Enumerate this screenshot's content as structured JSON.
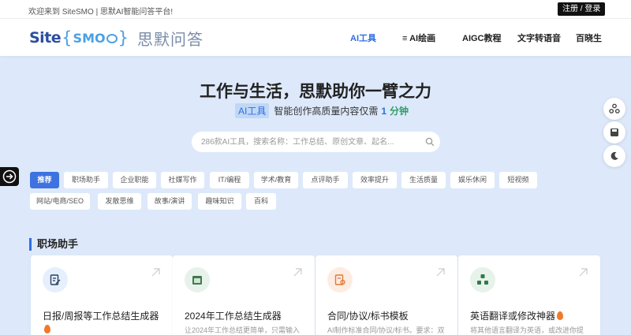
{
  "topbar": {
    "welcome": "欢迎来到 SiteSMO | 思默AI智能问答平台!",
    "login": "注册 / 登录"
  },
  "logo": {
    "site": "Site",
    "smo": "SMO",
    "cn": "思默问答"
  },
  "nav": {
    "ai_tools": "AI工具",
    "ai_paint": "≡ AI绘画",
    "aigc": "AIGC教程",
    "tts": "文字转语音",
    "baike": "百晓生"
  },
  "hero": {
    "title": "工作与生活，思默助你一臂之力",
    "tag": "AI工具",
    "sub_text": "智能创作高质量内容仅需",
    "num": "1",
    "unit": "分钟"
  },
  "search": {
    "placeholder": "286款AI工具，搜索名称：工作总结、原创文章、起名..."
  },
  "tags": [
    "推荐",
    "职场助手",
    "企业职能",
    "社媒写作",
    "IT/编程",
    "学术/教育",
    "点评助手",
    "效率提升",
    "生活质量",
    "娱乐休闲",
    "短视频",
    "网站/电商/SEO",
    "发散思维",
    "故事/演讲",
    "趣味知识",
    "百科"
  ],
  "section": {
    "title": "职场助手"
  },
  "cards": [
    {
      "title": "日报/周报等工作总结生成器",
      "desc": "",
      "hot": true
    },
    {
      "title": "2024年工作总结生成器",
      "desc": "让2024年工作总结更简单，只需输入",
      "hot": false
    },
    {
      "title": "合同/协议/标书模板",
      "desc": "AI制作标准合同/协议/标书。要求：双",
      "hot": false
    },
    {
      "title": "英语翻译或修改神器",
      "desc": "将其他语言翻译为英语，或改进你提",
      "hot": true
    }
  ],
  "colors": {
    "accent": "#2f6fe0",
    "background": "#dde9fa",
    "hot": "#f07a2a"
  }
}
